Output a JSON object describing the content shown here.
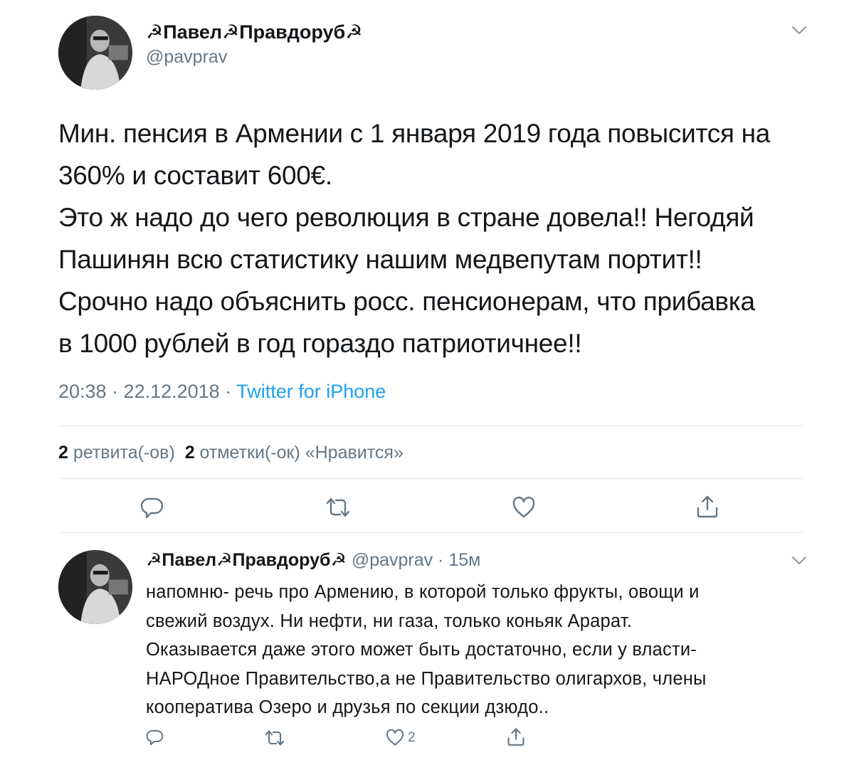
{
  "tweet": {
    "author_name": "☭Павел☭Правдоруб☭",
    "author_handle": "@pavprav",
    "text_lines": [
      "Мин. пенсия в Армении с 1 января 2019 года повысится на",
      "360% и составит 600€.",
      "Это ж надо до чего революция в стране довела!! Негодяй",
      "Пашинян всю статистику нашим медвепутам портит!!",
      "Срочно надо объяснить росс. пенсионерам, что прибавка",
      "в 1000 рублей в год гораздо патриотичнее!!"
    ],
    "time": "20:38 · 22.12.2018 · ",
    "source": "Twitter for iPhone",
    "retweet_count": "2",
    "retweet_label": "ретвита(-ов)",
    "like_count": "2",
    "like_label": "отметки(-ок) «Нравится»"
  },
  "reply": {
    "author_name": "☭Павел☭Правдоруб☭",
    "handle_time": "@pavprav · 15м",
    "text_lines": [
      "напомню- речь про Армению, в которой только фрукты, овощи и",
      "свежий воздух. Ни нефти, ни газа, только коньяк Арарат.",
      "Оказывается даже этого может быть достаточно, если у власти-",
      "НАРОДное Правительство,а не Правительство олигархов, члены",
      "кооператива Озеро и друзья по секции дзюдо.."
    ],
    "like_count": "2"
  },
  "colors": {
    "text": "#14171a",
    "secondary": "#657786",
    "link": "#1da1f2",
    "divider": "#e1e8ed"
  },
  "icons": {
    "reply": "reply-icon",
    "retweet": "retweet-icon",
    "like": "heart-icon",
    "share": "share-icon",
    "menu": "chevron-down-icon"
  }
}
